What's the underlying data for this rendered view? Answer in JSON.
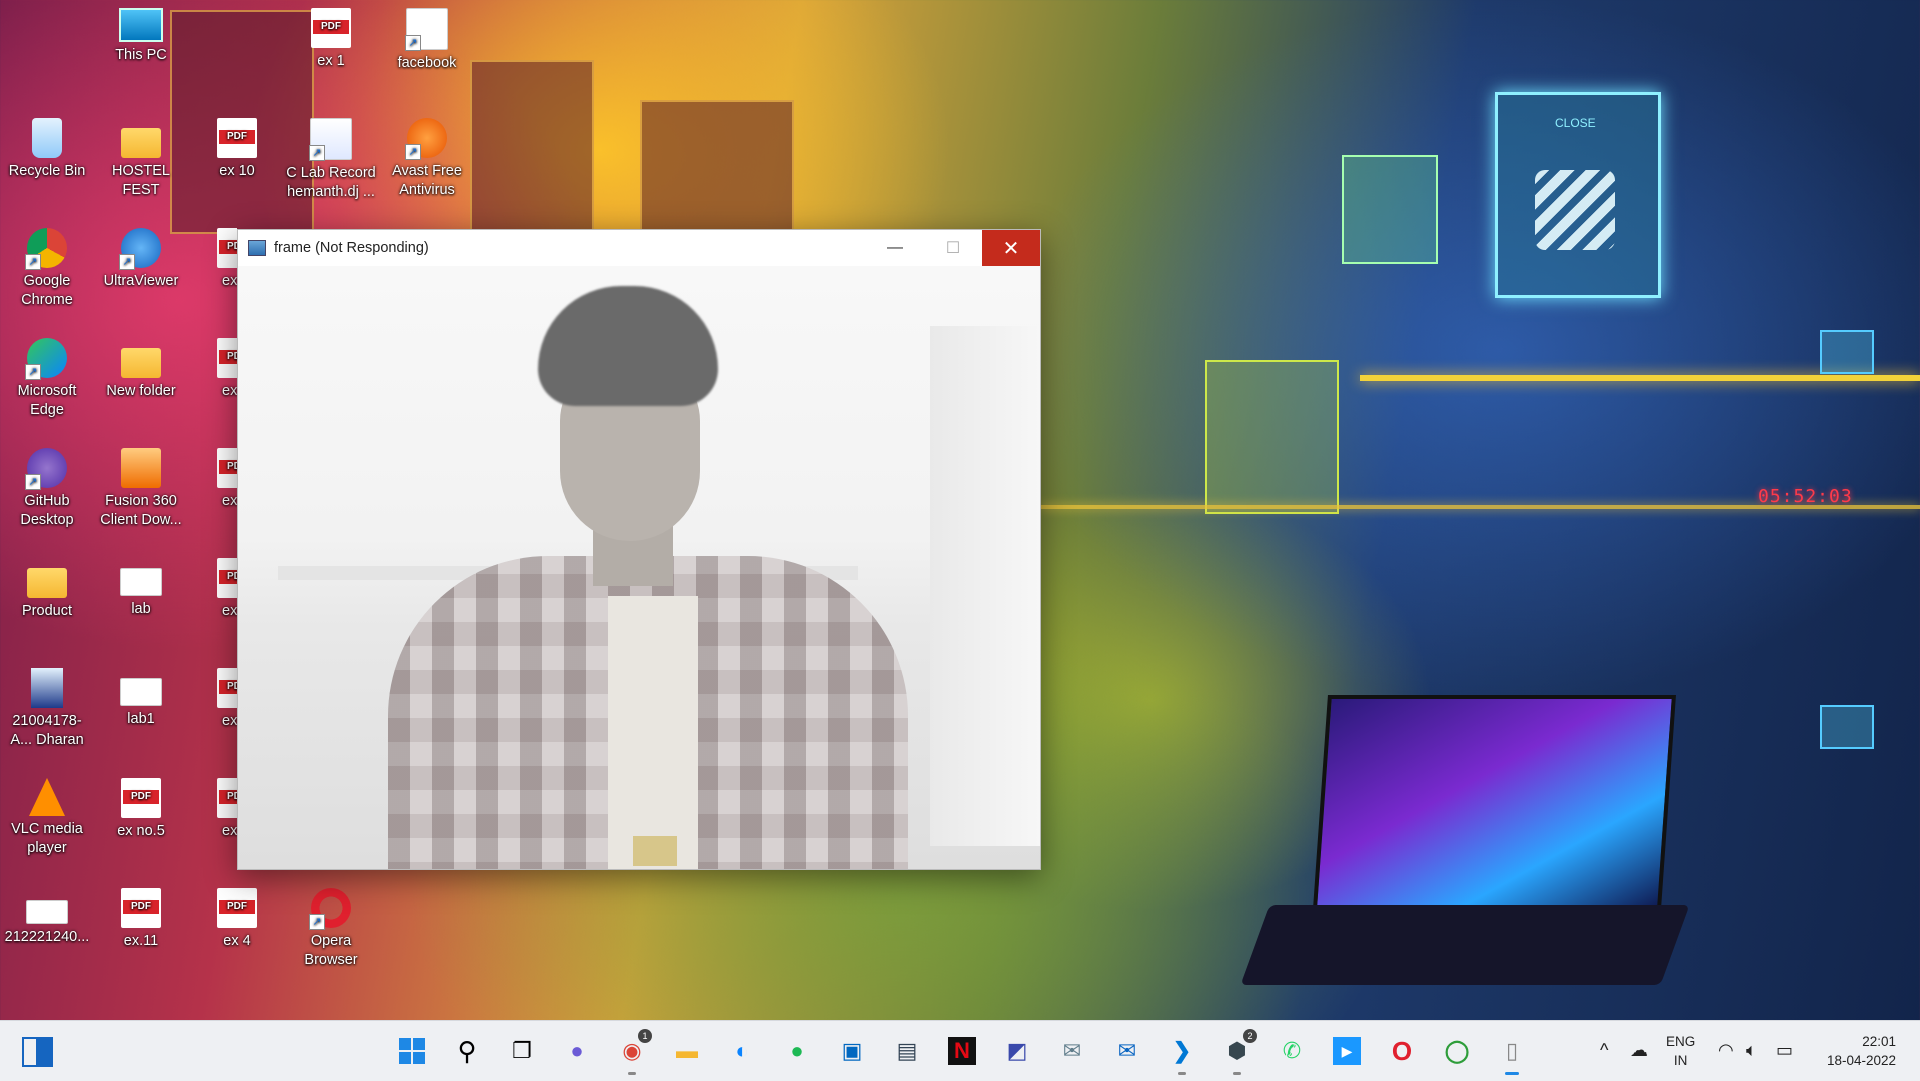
{
  "desktop": {
    "icons": [
      {
        "label": "This PC",
        "icon": "computer-icon"
      },
      {
        "label": "ex 1",
        "icon": "pdf-file-icon"
      },
      {
        "label": "facebook",
        "icon": "file-shortcut-icon"
      },
      {
        "label": "Recycle Bin",
        "icon": "recycle-bin-icon"
      },
      {
        "label": "HOSTEL FEST",
        "icon": "folder-icon"
      },
      {
        "label": "ex 10",
        "icon": "pdf-file-icon"
      },
      {
        "label": "C Lab Record hemanth.dj ...",
        "icon": "document-shortcut-icon"
      },
      {
        "label": "Avast Free Antivirus",
        "icon": "avast-icon"
      },
      {
        "label": "Google Chrome",
        "icon": "chrome-icon"
      },
      {
        "label": "UltraViewer",
        "icon": "ultraviewer-icon"
      },
      {
        "label": "Microsoft Edge",
        "icon": "edge-icon"
      },
      {
        "label": "New folder",
        "icon": "folder-icon"
      },
      {
        "label": "GitHub Desktop",
        "icon": "github-icon"
      },
      {
        "label": "Fusion 360 Client Dow...",
        "icon": "fusion-icon"
      },
      {
        "label": "Product",
        "icon": "folder-icon"
      },
      {
        "label": "lab",
        "icon": "image-file-icon"
      },
      {
        "label": "21004178-A... Dharan",
        "icon": "photo-icon"
      },
      {
        "label": "lab1",
        "icon": "image-file-icon"
      },
      {
        "label": "VLC media player",
        "icon": "vlc-icon"
      },
      {
        "label": "ex no.5",
        "icon": "pdf-file-icon"
      },
      {
        "label": "212221240...",
        "icon": "image-file-icon"
      },
      {
        "label": "ex.11",
        "icon": "pdf-file-icon"
      },
      {
        "label": "ex 4",
        "icon": "pdf-file-icon"
      },
      {
        "label": "Opera Browser",
        "icon": "opera-icon"
      },
      {
        "label": "ex",
        "icon": "pdf-file-icon"
      }
    ]
  },
  "window": {
    "title": "frame (Not Responding)",
    "minimize": "—",
    "maximize": "☐",
    "close": "✕"
  },
  "wallpaper": {
    "clock": "05:52:03",
    "panel_text": "CLOSE"
  },
  "taskbar": {
    "apps": [
      {
        "name": "start",
        "icon": "windows-start-icon"
      },
      {
        "name": "search",
        "icon": "search-icon",
        "glyph": "⚲"
      },
      {
        "name": "task view",
        "icon": "task-view-icon",
        "glyph": "❐"
      },
      {
        "name": "chat",
        "icon": "chat-icon",
        "glyph": "●"
      },
      {
        "name": "chrome",
        "icon": "chrome-icon",
        "glyph": "◉",
        "badge": "1"
      },
      {
        "name": "file explorer",
        "icon": "folder-icon",
        "glyph": "▬"
      },
      {
        "name": "edge",
        "icon": "edge-icon",
        "glyph": "◐"
      },
      {
        "name": "spotify",
        "icon": "spotify-icon",
        "glyph": "●"
      },
      {
        "name": "store",
        "icon": "store-icon",
        "glyph": "▣"
      },
      {
        "name": "photos",
        "icon": "photos-icon",
        "glyph": "▤"
      },
      {
        "name": "netflix",
        "icon": "netflix-icon",
        "glyph": "N"
      },
      {
        "name": "whiteboard",
        "icon": "whiteboard-icon",
        "glyph": "◩"
      },
      {
        "name": "mail app",
        "icon": "mail-open-icon",
        "glyph": "✉"
      },
      {
        "name": "mail",
        "icon": "mail-icon",
        "glyph": "✉"
      },
      {
        "name": "vs code",
        "icon": "vscode-icon",
        "glyph": "❯"
      },
      {
        "name": "app cube",
        "icon": "cube-icon",
        "glyph": "⬢",
        "badge": "2"
      },
      {
        "name": "whatsapp",
        "icon": "whatsapp-icon",
        "glyph": "✆"
      },
      {
        "name": "prime video",
        "icon": "prime-video-icon",
        "glyph": "▶"
      },
      {
        "name": "opera",
        "icon": "opera-icon",
        "glyph": "O"
      },
      {
        "name": "app ring",
        "icon": "ring-app-icon",
        "glyph": "◯"
      },
      {
        "name": "file",
        "icon": "blank-file-icon",
        "glyph": "▯"
      }
    ],
    "tray": {
      "chevron": "^",
      "lang_top": "ENG",
      "lang_bottom": "IN",
      "time": "22:01",
      "date": "18-04-2022"
    }
  },
  "colors": {
    "close_button": "#c42b1c",
    "pdf_red": "#d8232a",
    "accent": "#1e88e5"
  }
}
